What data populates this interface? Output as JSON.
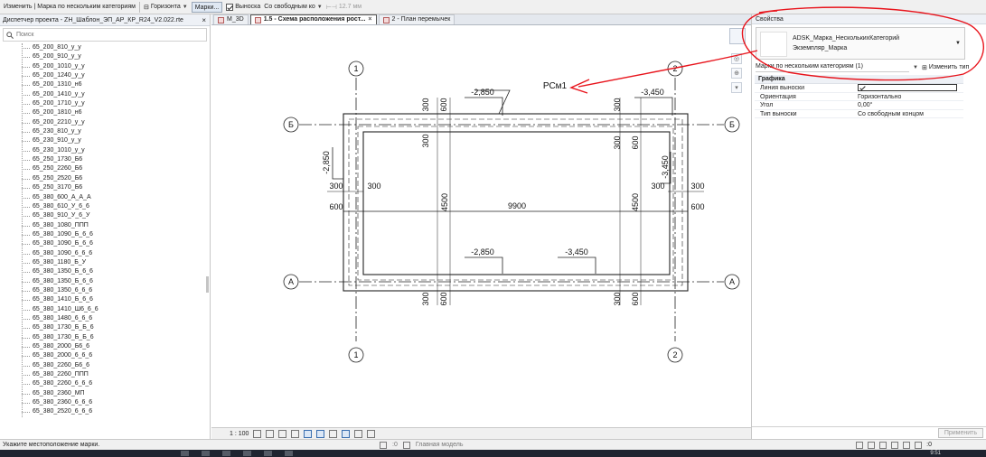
{
  "options_bar": {
    "mode": "Изменить | Марка по нескольким категориям",
    "orientation": "Горизонта",
    "tags_button": "Марки...",
    "leader_label": "Выноска",
    "leader_checked": true,
    "leader_type": "Со свободным ко",
    "leader_length": "12.7 мм"
  },
  "project_browser": {
    "title": "Диспетчер проекта - ZH_Шаблон_ЭП_АР_КР_R24_V2.022.rte",
    "close": "×",
    "search_placeholder": "Поиск",
    "items": [
      "65_200_810_у_у",
      "65_200_910_у_у",
      "65_200_1010_у_у",
      "65_200_1240_у_у",
      "65_200_1310_н6",
      "65_200_1410_у_у",
      "65_200_1710_у_у",
      "65_200_1810_н6",
      "65_200_2210_у_у",
      "65_230_810_у_у",
      "65_230_910_у_у",
      "65_230_1010_у_у",
      "65_250_1730_Б6",
      "65_250_2260_Б6",
      "65_250_2520_Б6",
      "65_250_3170_Б6",
      "65_380_600_А_А_А",
      "65_380_610_У_6_6",
      "65_380_910_У_6_У",
      "65_380_1080_ППП",
      "65_380_1090_Б_6_6",
      "65_380_1090_Б_6_6",
      "65_380_1090_6_6_6",
      "65_380_1180_Б_У",
      "65_380_1350_Б_6_6",
      "65_380_1350_Б_6_6",
      "65_380_1350_6_6_6",
      "65_380_1410_Б_6_6",
      "65_380_1410_Ш6_6_6",
      "65_380_1480_6_6_6",
      "65_380_1730_Б_Б_6",
      "65_380_1730_Б_Б_6",
      "65_380_2000_Б6_6",
      "65_380_2000_6_6_6",
      "65_380_2260_Б6_6",
      "65_380_2260_ППП",
      "65_380_2260_6_6_6",
      "65_380_2360_МП",
      "65_380_2360_6_6_6",
      "65_380_2520_6_6_6"
    ]
  },
  "tabs": [
    {
      "label": "М_3D",
      "active": false
    },
    {
      "label": "1.5 - Схема расположения рост...",
      "active": true
    },
    {
      "label": "2 - План перемычек",
      "active": false
    }
  ],
  "tab_close": "×",
  "drawing": {
    "grid_numbers": [
      "1",
      "2"
    ],
    "grid_letters": [
      "Б",
      "А"
    ],
    "tag": "РСм1",
    "elevations": [
      "-2,850",
      "-3,450",
      "-2,850",
      "-3,450"
    ],
    "left_elevation": "-2,850",
    "right_elevation": "-3,450",
    "overall_width": "9900",
    "span": "4500",
    "dim_300": "300",
    "dim_600": "600"
  },
  "view_control": {
    "scale": "1 : 100"
  },
  "properties": {
    "title": "Свойства",
    "family": "ADSK_Марка_НесколькихКатегорий",
    "type": "Экземпляр_Марка",
    "instance_selector": "Марки по нескольким категориям (1)",
    "edit_type": "Изменить тип",
    "group": "Графика",
    "rows": [
      {
        "key": "Линия выноски",
        "value": ""
      },
      {
        "key": "Ориентация",
        "value": "Горизонтально"
      },
      {
        "key": "Угол",
        "value": "0,00°"
      },
      {
        "key": "Тип выноски",
        "value": "Со свободным концом"
      }
    ],
    "leader_line_checked": true,
    "apply": "Применить"
  },
  "status_bar": {
    "message": "Укажите местоположение марки.",
    "count": ":0",
    "model": "Главная модель",
    "filter_count": ":0"
  },
  "taskbar": {
    "clock": "9:51"
  },
  "annotation_color": "#e8141c"
}
